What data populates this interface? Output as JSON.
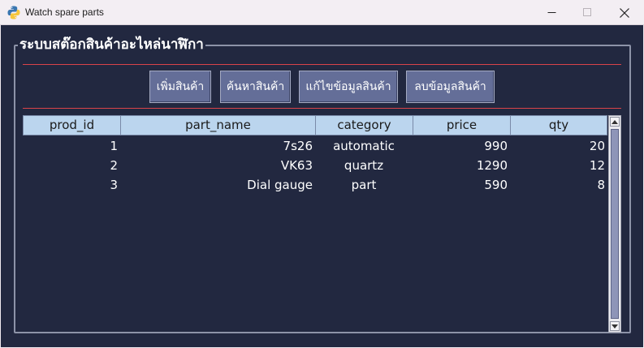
{
  "window": {
    "title": "Watch spare parts"
  },
  "group": {
    "title": "ระบบสต๊อกสินค้าอะไหล่นาฬิกา"
  },
  "buttons": {
    "add": "เพิ่มสินค้า",
    "search": "ค้นหาสินค้า",
    "edit": "แก้ไขข้อมูลสินค้า",
    "delete": "ลบข้อมูลสินค้า"
  },
  "table": {
    "columns": [
      "prod_id",
      "part_name",
      "category",
      "price",
      "qty"
    ],
    "rows": [
      [
        "1",
        "7s26",
        "automatic",
        "990",
        "20"
      ],
      [
        "2",
        "VK63",
        "quartz",
        "1290",
        "12"
      ],
      [
        "3",
        "Dial gauge",
        "part",
        "590",
        "8"
      ]
    ]
  },
  "colors": {
    "background": "#222840",
    "header": "#bbd5ee",
    "button": "#646e98",
    "separator": "#d9434a"
  }
}
